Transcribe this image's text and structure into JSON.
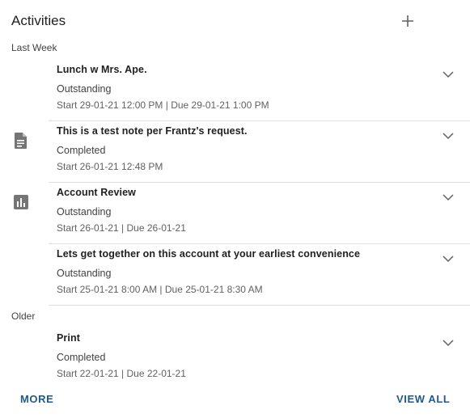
{
  "header": {
    "title": "Activities",
    "add_icon": "plus-icon"
  },
  "groups": {
    "last_week": "Last Week",
    "older": "Older"
  },
  "items": [
    {
      "subject": "Lunch w Mrs. Ape.",
      "status": "Outstanding",
      "dates": "Start 29-01-21 12:00 PM | Due 29-01-21 1:00 PM",
      "icon": ""
    },
    {
      "subject": "This is a test note per Frantz's request.",
      "status": "Completed",
      "dates": "Start 26-01-21 12:48 PM",
      "icon": "note-icon"
    },
    {
      "subject": "Account Review",
      "status": "Outstanding",
      "dates": "Start 26-01-21 | Due 26-01-21",
      "icon": "chart-icon"
    },
    {
      "subject": "Lets get together on this account at your earliest convenience",
      "status": "Outstanding",
      "dates": "Start 25-01-21 8:00 AM | Due 25-01-21 8:30 AM",
      "icon": ""
    },
    {
      "subject": "Print",
      "status": "Completed",
      "dates": "Start 22-01-21 | Due 22-01-21",
      "icon": ""
    }
  ],
  "footer": {
    "more_label": "MORE",
    "view_all_label": "VIEW ALL"
  },
  "colors": {
    "accent": "#1e5a8e",
    "icon": "#757575",
    "divider": "#e0e0e0"
  }
}
